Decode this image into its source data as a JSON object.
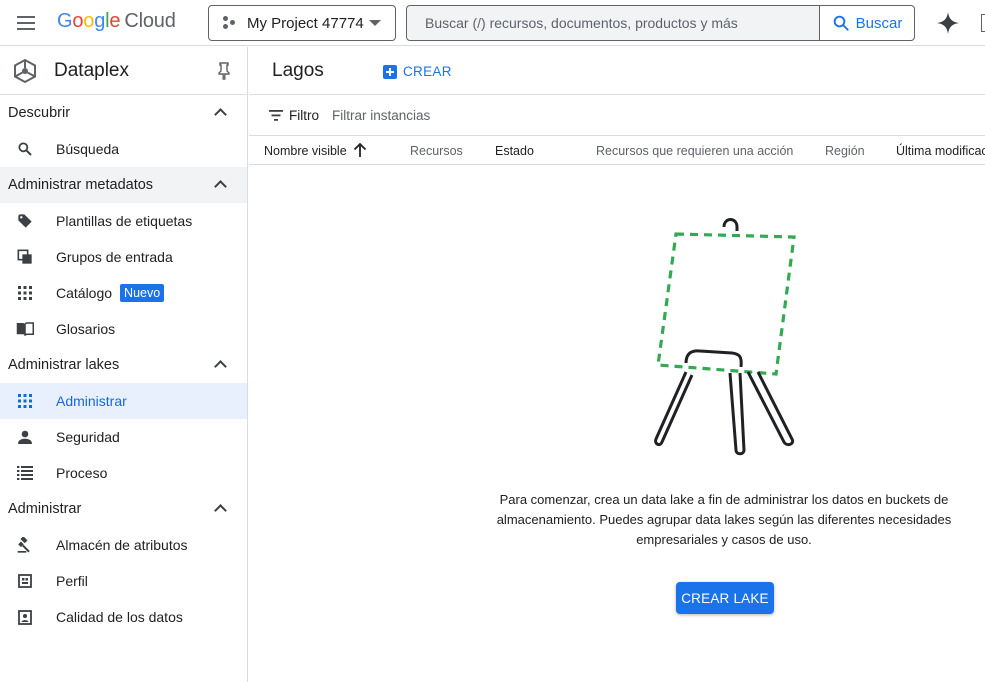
{
  "header": {
    "logo_google": [
      "G",
      "o",
      "o",
      "g",
      "l",
      "e"
    ],
    "logo_cloud": "Cloud",
    "project_name": "My Project 47774",
    "search_placeholder": "Buscar (/) recursos, documentos, productos y más",
    "search_button": "Buscar"
  },
  "sidebar": {
    "product_name": "Dataplex",
    "sections": [
      {
        "label": "Descubrir",
        "items": [
          {
            "label": "Búsqueda",
            "icon": "search-icon"
          }
        ]
      },
      {
        "label": "Administrar metadatos",
        "items": [
          {
            "label": "Plantillas de etiquetas",
            "icon": "tag-icon"
          },
          {
            "label": "Grupos de entrada",
            "icon": "entry-groups-icon"
          },
          {
            "label": "Catálogo",
            "icon": "grid-icon",
            "badge": "Nuevo"
          },
          {
            "label": "Glosarios",
            "icon": "book-icon"
          }
        ]
      },
      {
        "label": "Administrar lakes",
        "items": [
          {
            "label": "Administrar",
            "icon": "grid-icon"
          },
          {
            "label": "Seguridad",
            "icon": "person-icon"
          },
          {
            "label": "Proceso",
            "icon": "list-icon"
          }
        ]
      },
      {
        "label": "Administrar",
        "items": [
          {
            "label": "Almacén de atributos",
            "icon": "gavel-icon"
          },
          {
            "label": "Perfil",
            "icon": "profile-icon"
          },
          {
            "label": "Calidad de los datos",
            "icon": "quality-icon"
          }
        ]
      }
    ]
  },
  "main": {
    "title": "Lagos",
    "create_button": "CREAR",
    "filter_label": "Filtro",
    "filter_placeholder": "Filtrar instancias",
    "columns": [
      "Nombre visible",
      "Recursos",
      "Estado",
      "Recursos que requieren una acción",
      "Región",
      "Última modificac"
    ],
    "empty_message": "Para comenzar, crea un data lake a fin de administrar los datos en buckets de almacenamiento. Puedes agrupar data lakes según las diferentes necesidades empresariales y casos de uso.",
    "create_lake_button": "CREAR LAKE"
  },
  "colors": {
    "accent": "#1a73e8",
    "active_bg": "#e8f0fe",
    "illustration_dash": "#34a853"
  }
}
